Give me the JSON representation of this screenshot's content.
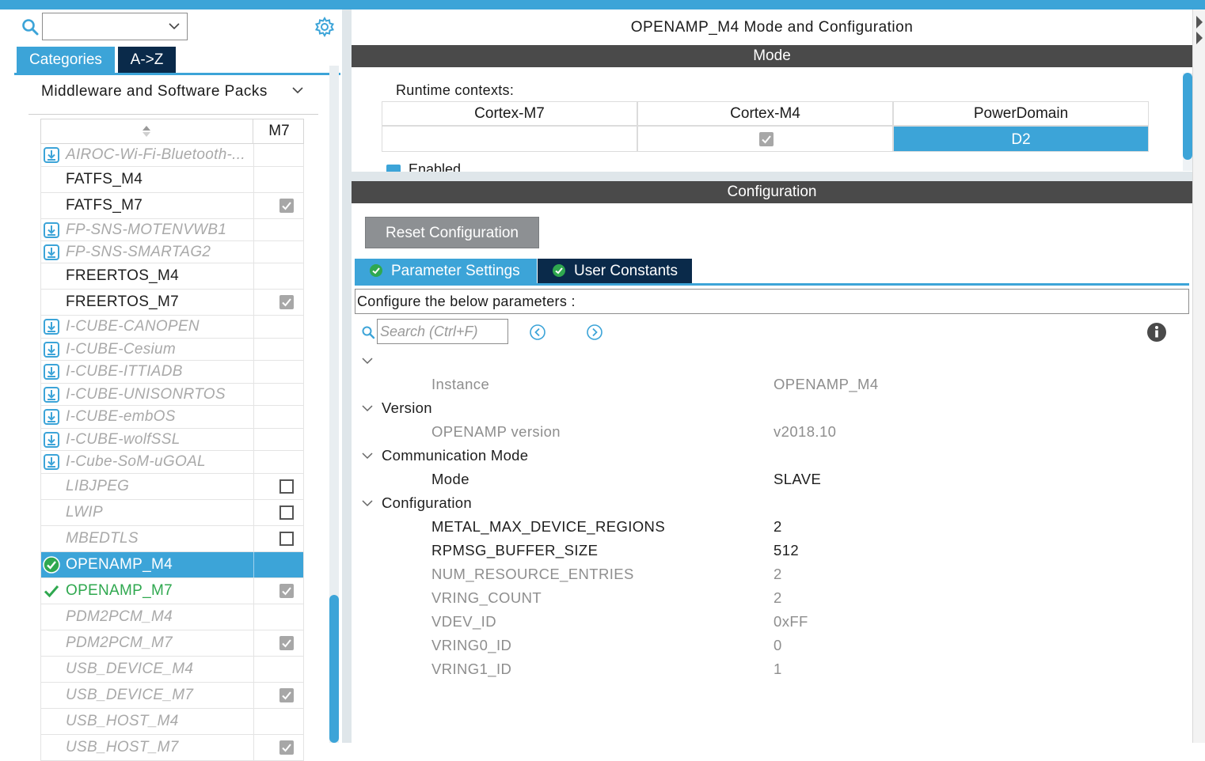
{
  "left": {
    "filter_value": "",
    "tabs": {
      "categories": "Categories",
      "az": "A->Z"
    },
    "group_title": "Middleware and Software Packs",
    "column_header": "M7",
    "items": [
      {
        "label": "AIROC-Wi-Fi-Bluetooth-...",
        "style": "dl",
        "check": "none",
        "icon": "download-icon"
      },
      {
        "label": "FATFS_M4",
        "style": "norm",
        "check": "none",
        "icon": ""
      },
      {
        "label": "FATFS_M7",
        "style": "norm",
        "check": "grey",
        "icon": ""
      },
      {
        "label": "FP-SNS-MOTENVWB1",
        "style": "dl",
        "check": "none",
        "icon": "download-icon"
      },
      {
        "label": "FP-SNS-SMARTAG2",
        "style": "dl",
        "check": "none",
        "icon": "download-icon"
      },
      {
        "label": "FREERTOS_M4",
        "style": "norm",
        "check": "none",
        "icon": ""
      },
      {
        "label": "FREERTOS_M7",
        "style": "norm",
        "check": "grey",
        "icon": ""
      },
      {
        "label": "I-CUBE-CANOPEN",
        "style": "dl",
        "check": "none",
        "icon": "download-icon"
      },
      {
        "label": "I-CUBE-Cesium",
        "style": "dl",
        "check": "none",
        "icon": "download-icon"
      },
      {
        "label": "I-CUBE-ITTIADB",
        "style": "dl",
        "check": "none",
        "icon": "download-icon"
      },
      {
        "label": "I-CUBE-UNISONRTOS",
        "style": "dl",
        "check": "none",
        "icon": "download-icon"
      },
      {
        "label": "I-CUBE-embOS",
        "style": "dl",
        "check": "none",
        "icon": "download-icon"
      },
      {
        "label": "I-CUBE-wolfSSL",
        "style": "dl",
        "check": "none",
        "icon": "download-icon"
      },
      {
        "label": "I-Cube-SoM-uGOAL",
        "style": "dl",
        "check": "none",
        "icon": "download-icon"
      },
      {
        "label": "LIBJPEG",
        "style": "gray",
        "check": "empty",
        "icon": ""
      },
      {
        "label": "LWIP",
        "style": "gray",
        "check": "empty",
        "icon": ""
      },
      {
        "label": "MBEDTLS",
        "style": "gray",
        "check": "empty",
        "icon": ""
      },
      {
        "label": "OPENAMP_M4",
        "style": "sel",
        "check": "none",
        "icon": "check-circle-icon"
      },
      {
        "label": "OPENAMP_M7",
        "style": "green",
        "check": "grey",
        "icon": "checkmark-icon"
      },
      {
        "label": "PDM2PCM_M4",
        "style": "gray",
        "check": "none",
        "icon": ""
      },
      {
        "label": "PDM2PCM_M7",
        "style": "gray",
        "check": "grey",
        "icon": ""
      },
      {
        "label": "USB_DEVICE_M4",
        "style": "gray",
        "check": "none",
        "icon": ""
      },
      {
        "label": "USB_DEVICE_M7",
        "style": "gray",
        "check": "grey",
        "icon": ""
      },
      {
        "label": "USB_HOST_M4",
        "style": "gray",
        "check": "none",
        "icon": ""
      },
      {
        "label": "USB_HOST_M7",
        "style": "gray",
        "check": "grey",
        "icon": ""
      }
    ]
  },
  "right": {
    "title": "OPENAMP_M4 Mode and Configuration",
    "mode_header": "Mode",
    "runtime_label": "Runtime contexts:",
    "contexts": {
      "headers": [
        "Cortex-M7",
        "Cortex-M4",
        "PowerDomain"
      ],
      "m4_checked": true,
      "power_domain": "D2"
    },
    "enabled_label": "Enabled",
    "config_header": "Configuration",
    "reset_label": "Reset Configuration",
    "tabs": {
      "params": "Parameter Settings",
      "constants": "User Constants"
    },
    "configure_text": "Configure the below parameters :",
    "search_placeholder": "Search (Ctrl+F)",
    "params": {
      "instance": {
        "k": "Instance",
        "v": "OPENAMP_M4"
      },
      "sec_version": "Version",
      "version": {
        "k": "OPENAMP version",
        "v": "v2018.10"
      },
      "sec_comm": "Communication Mode",
      "mode": {
        "k": "Mode",
        "v": "SLAVE"
      },
      "sec_config": "Configuration",
      "metal": {
        "k": "METAL_MAX_DEVICE_REGIONS",
        "v": "2"
      },
      "rpmsg": {
        "k": "RPMSG_BUFFER_SIZE",
        "v": "512"
      },
      "numres": {
        "k": "NUM_RESOURCE_ENTRIES",
        "v": "2"
      },
      "vringcount": {
        "k": "VRING_COUNT",
        "v": "2"
      },
      "vdev": {
        "k": "VDEV_ID",
        "v": "0xFF"
      },
      "vring0": {
        "k": "VRING0_ID",
        "v": "0"
      },
      "vring1": {
        "k": "VRING1_ID",
        "v": "1"
      }
    }
  },
  "colors": {
    "accent": "#3ca4d8",
    "dark_tab": "#0a2a4a",
    "header_bar": "#4a4a4a",
    "green": "#2fa84f"
  }
}
